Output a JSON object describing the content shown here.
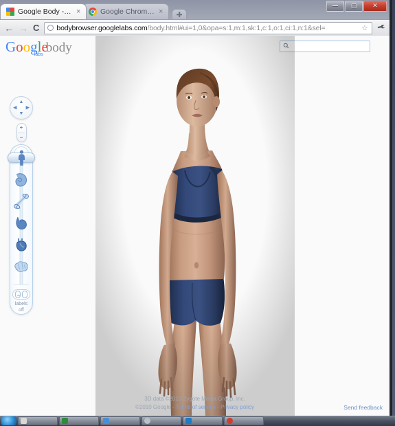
{
  "window": {
    "controls": {
      "minimize": "—",
      "maximize": "▢",
      "close": "✕"
    }
  },
  "tabs": [
    {
      "label": "Google Body - G...",
      "favicon": "google-body-favicon",
      "close": "×",
      "active": true
    },
    {
      "label": "Google Chrome ...",
      "favicon": "chrome-favicon",
      "close": "×",
      "active": false
    }
  ],
  "newtab_label": "+",
  "toolbar": {
    "back": "←",
    "forward": "→",
    "reload": "C",
    "url_prefix": "bodybrowser.googlelabs.com",
    "url_suffix": "/body.html#ui=1,0&opa=s:1,m:1,sk:1,c:1,o:1,ci:1,n:1&sel=",
    "star": "☆",
    "wrench": "🔧"
  },
  "logo": {
    "g": "G",
    "o1": "o",
    "o2": "o",
    "g2": "g",
    "l": "l",
    "e": "e",
    "labs": "labs",
    "body": "body"
  },
  "search": {
    "placeholder": "",
    "value": "",
    "icon": "search-icon"
  },
  "nav_controls": {
    "pan_up": "▲",
    "pan_down": "▼",
    "pan_left": "◀",
    "pan_right": "▶",
    "zoom_in": "+",
    "zoom_out": "−"
  },
  "layers": [
    {
      "name": "skin",
      "selected": true
    },
    {
      "name": "muscle",
      "selected": false
    },
    {
      "name": "skeleton",
      "selected": false
    },
    {
      "name": "organs",
      "selected": false
    },
    {
      "name": "circulatory",
      "selected": false
    },
    {
      "name": "nervous",
      "selected": false
    }
  ],
  "labels_toggle": {
    "line1": "labels",
    "line2": "off",
    "state": "off"
  },
  "footer": {
    "line1": "3D data ©2010 Zygote Media Group, Inc.",
    "copyright": "©2010 Google -",
    "terms": "Terms of service",
    "dash": "-",
    "privacy": "Privacy policy",
    "send_feedback": "Send feedback"
  },
  "colors": {
    "accent_blue": "#4285f4",
    "model_garment": "#2e4269",
    "model_skin": "#c49a7f",
    "page_bg": "#fafafa",
    "chrome_frame": "#cfd3dc"
  },
  "taskbar": {
    "items": [
      "item-1",
      "item-2",
      "item-3",
      "item-4",
      "item-5",
      "item-6"
    ]
  }
}
